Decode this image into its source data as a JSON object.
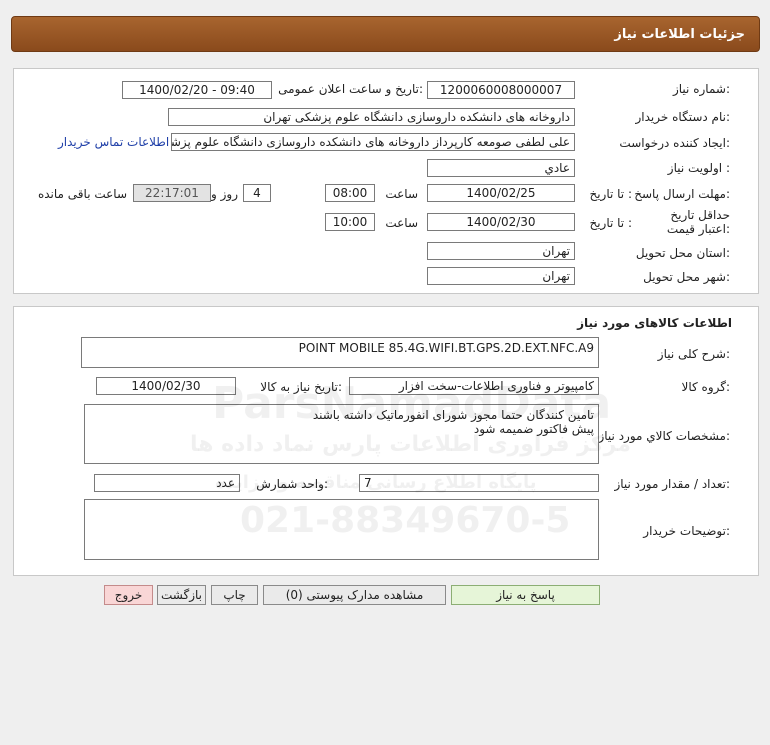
{
  "header": {
    "title": "جزئیات اطلاعات نیاز"
  },
  "details": {
    "need_number_label": "شماره نیاز:",
    "need_number": "1200060008000007",
    "announce_label": "تاریخ و ساعت اعلان عمومی:",
    "announce_value": "1400/02/20 - 09:40",
    "buyer_label": "نام دستگاه خریدار:",
    "buyer": "داروخانه های دانشکده داروسازی دانشگاه علوم پزشکی تهران",
    "creator_label": "ایجاد کننده درخواست:",
    "creator": "علی لطفی صومعه کارپرداز داروخانه های دانشکده داروسازی دانشگاه علوم پزشکی تهران",
    "contact_link": "اطلاعات تماس خریدار",
    "priority_label": "اولویت نیاز :",
    "priority": "عادي",
    "deadline_label": "مهلت ارسال پاسخ:",
    "to_date_label": "تا تاریخ :",
    "deadline_date": "1400/02/25",
    "time_label": "ساعت",
    "deadline_time": "08:00",
    "days_value": "4",
    "days_label": "روز و",
    "remaining_time": "22:17:01",
    "remaining_label": "ساعت باقی مانده",
    "validity_label": "حداقل تاریخ اعتبار قیمت:",
    "validity_to_label": "تا تاریخ :",
    "validity_date": "1400/02/30",
    "validity_time_label": "ساعت",
    "validity_time": "10:00",
    "province_label": "استان محل تحویل:",
    "province": "تهران",
    "city_label": "شهر محل تحویل:",
    "city": "تهران"
  },
  "goods": {
    "section_title": "اطلاعات کالاهای مورد نیاز",
    "desc_label": "شرح کلی نیاز:",
    "desc": "POINT MOBILE 85.4G.WIFI.BT.GPS.2D.EXT.NFC.A9",
    "group_label": "گروه کالا:",
    "group": "کامپیوتر و فناوری اطلاعات-سخت افزار",
    "need_date_label": "تاریخ نیاز به کالا:",
    "need_date": "1400/02/30",
    "specs_label": "مشخصات کالاي مورد نياز:",
    "specs_line1": "تامین کنندگان حتما مجوز شورای انفورماتیک داشته باشند",
    "specs_line2": "پیش فاکتور ضمیمه شود",
    "qty_label": "تعداد / مقدار مورد نیاز:",
    "qty": "7",
    "unit_label": "واحد شمارش:",
    "unit": "عدد",
    "buyer_notes_label": "توضیحات خریدار:",
    "buyer_notes": ""
  },
  "buttons": {
    "reply": "پاسخ به نیاز",
    "attachments": "مشاهده مدارک پیوستی (0)",
    "print": "چاپ",
    "back": "بازگشت",
    "exit": "خروج"
  },
  "watermark": {
    "brand": "ParsNamadData",
    "tagline": "مرکز فراوری اطلاعات پارس نماد داده ها",
    "subtitle": "پایگاه اطلاع رسانی مناقصه و مزایده",
    "phone": "021-88349670-5"
  }
}
